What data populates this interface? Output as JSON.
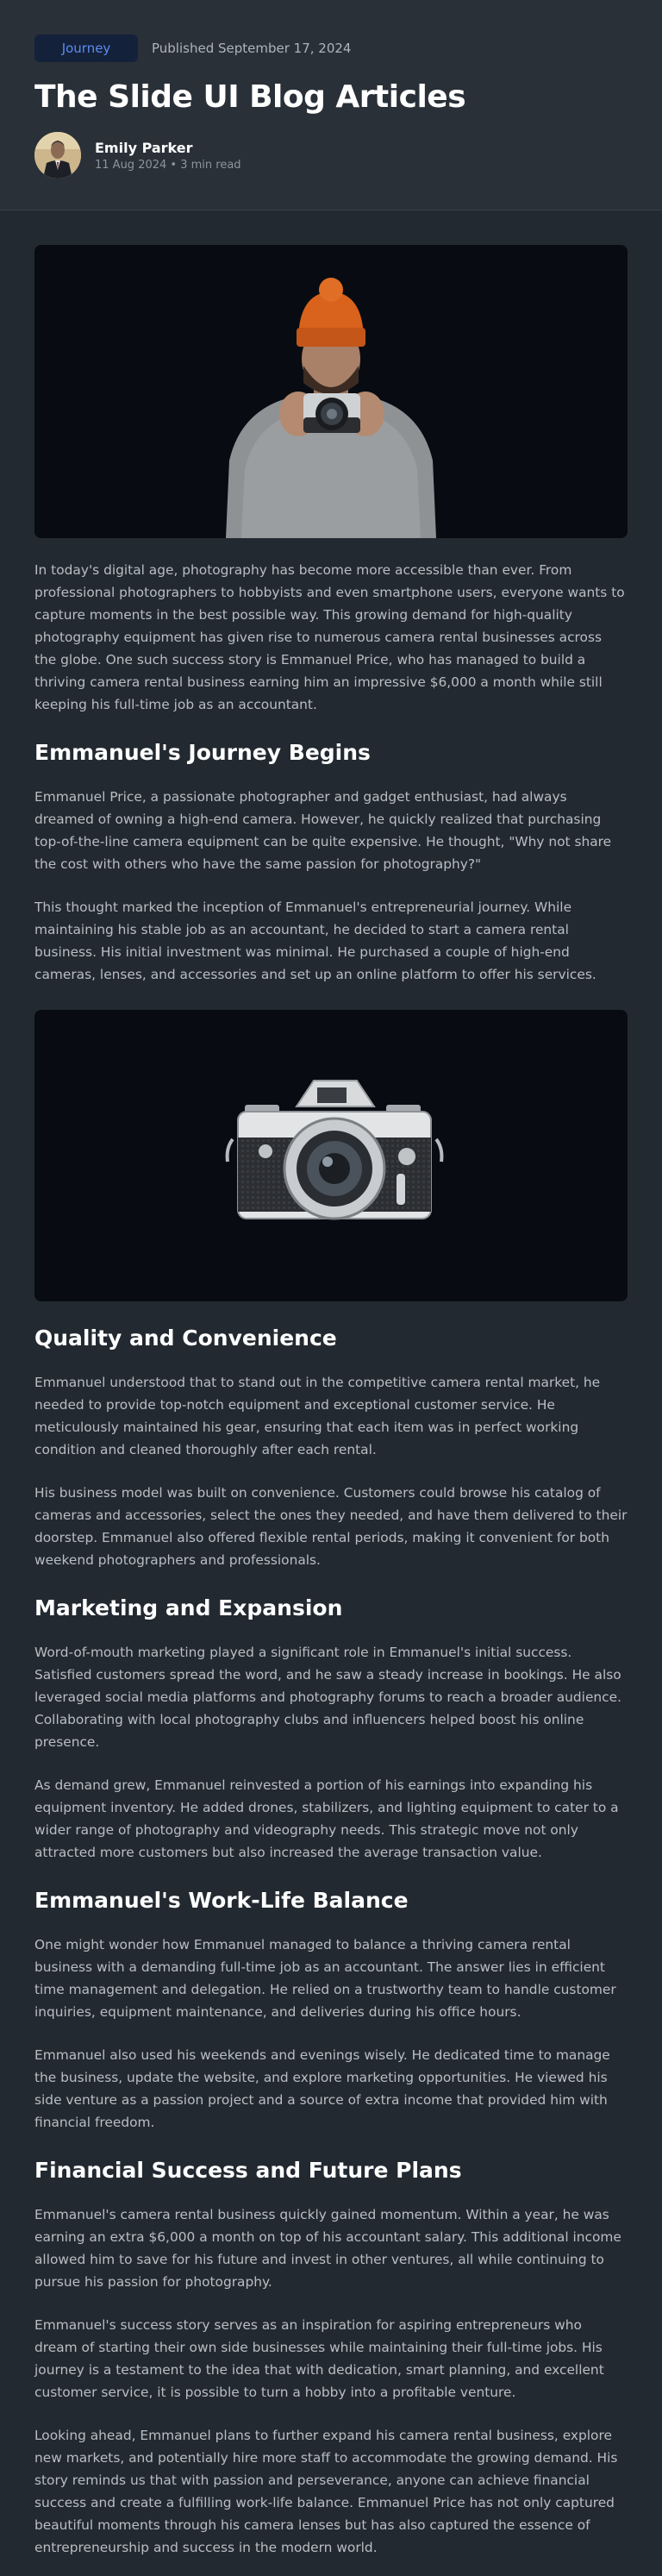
{
  "header": {
    "tag": "Journey",
    "published": "Published September 17, 2024",
    "title": "The Slide UI Blog Articles",
    "author": {
      "name": "Emily Parker",
      "meta": "11 Aug 2024 • 3 min read"
    }
  },
  "article": {
    "intro": "In today's digital age, photography has become more accessible than ever. From professional photographers to hobbyists and even smartphone users, everyone wants to capture moments in the best possible way. This growing demand for high-quality photography equipment has given rise to numerous camera rental businesses across the globe. One such success story is Emmanuel Price, who has managed to build a thriving camera rental business earning him an impressive $6,000 a month while still keeping his full-time job as an accountant.",
    "sections": [
      {
        "heading": "Emmanuel's Journey Begins",
        "paragraphs": [
          "Emmanuel Price, a passionate photographer and gadget enthusiast, had always dreamed of owning a high-end camera. However, he quickly realized that purchasing top-of-the-line camera equipment can be quite expensive. He thought, \"Why not share the cost with others who have the same passion for photography?\"",
          "This thought marked the inception of Emmanuel's entrepreneurial journey. While maintaining his stable job as an accountant, he decided to start a camera rental business. His initial investment was minimal. He purchased a couple of high-end cameras, lenses, and accessories and set up an online platform to offer his services."
        ]
      },
      {
        "heading": "Quality and Convenience",
        "paragraphs": [
          "Emmanuel understood that to stand out in the competitive camera rental market, he needed to provide top-notch equipment and exceptional customer service. He meticulously maintained his gear, ensuring that each item was in perfect working condition and cleaned thoroughly after each rental.",
          "His business model was built on convenience. Customers could browse his catalog of cameras and accessories, select the ones they needed, and have them delivered to their doorstep. Emmanuel also offered flexible rental periods, making it convenient for both weekend photographers and professionals."
        ]
      },
      {
        "heading": "Marketing and Expansion",
        "paragraphs": [
          "Word-of-mouth marketing played a significant role in Emmanuel's initial success. Satisfied customers spread the word, and he saw a steady increase in bookings. He also leveraged social media platforms and photography forums to reach a broader audience. Collaborating with local photography clubs and influencers helped boost his online presence.",
          "As demand grew, Emmanuel reinvested a portion of his earnings into expanding his equipment inventory. He added drones, stabilizers, and lighting equipment to cater to a wider range of photography and videography needs. This strategic move not only attracted more customers but also increased the average transaction value."
        ]
      },
      {
        "heading": "Emmanuel's Work-Life Balance",
        "paragraphs": [
          "One might wonder how Emmanuel managed to balance a thriving camera rental business with a demanding full-time job as an accountant. The answer lies in efficient time management and delegation. He relied on a trustworthy team to handle customer inquiries, equipment maintenance, and deliveries during his office hours.",
          "Emmanuel also used his weekends and evenings wisely. He dedicated time to manage the business, update the website, and explore marketing opportunities. He viewed his side venture as a passion project and a source of extra income that provided him with financial freedom."
        ]
      },
      {
        "heading": "Financial Success and Future Plans",
        "paragraphs": [
          "Emmanuel's camera rental business quickly gained momentum. Within a year, he was earning an extra $6,000 a month on top of his accountant salary. This additional income allowed him to save for his future and invest in other ventures, all while continuing to pursue his passion for photography.",
          "Emmanuel's success story serves as an inspiration for aspiring entrepreneurs who dream of starting their own side businesses while maintaining their full-time jobs. His journey is a testament to the idea that with dedication, smart planning, and excellent customer service, it is possible to turn a hobby into a profitable venture.",
          "Looking ahead, Emmanuel plans to further expand his camera rental business, explore new markets, and potentially hire more staff to accommodate the growing demand. His story reminds us that with passion and perseverance, anyone can achieve financial success and create a fulfilling work-life balance. Emmanuel Price has not only captured beautiful moments through his camera lenses but has also captured the essence of entrepreneurship and success in the modern world."
        ]
      }
    ]
  },
  "colors": {
    "background": "#222930",
    "header_bg": "#2a3038",
    "tag_bg": "#14213a",
    "tag_text": "#5b8cf0",
    "accent_hat": "#d9621c"
  }
}
